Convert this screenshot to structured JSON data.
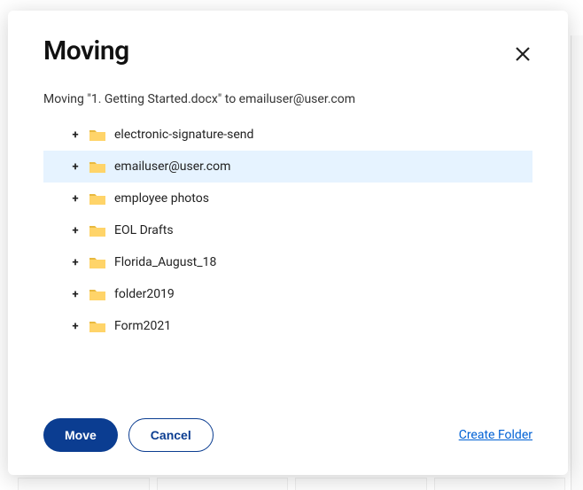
{
  "modal": {
    "title": "Moving",
    "subtitle": "Moving \"1. Getting Started.docx\" to emailuser@user.com",
    "move_label": "Move",
    "cancel_label": "Cancel",
    "create_folder_label": "Create Folder"
  },
  "folders": [
    {
      "label": "electronic-signature-send",
      "selected": false
    },
    {
      "label": "emailuser@user.com",
      "selected": true
    },
    {
      "label": "employee photos",
      "selected": false
    },
    {
      "label": "EOL Drafts",
      "selected": false
    },
    {
      "label": "Florida_August_18",
      "selected": false
    },
    {
      "label": "folder2019",
      "selected": false
    },
    {
      "label": "Form2021",
      "selected": false
    }
  ],
  "colors": {
    "primary_button": "#0b3d91",
    "link": "#0061d5",
    "selection_bg": "#e6f3ff",
    "folder_fill": "#ffd469",
    "folder_tab": "#e8b93f"
  }
}
